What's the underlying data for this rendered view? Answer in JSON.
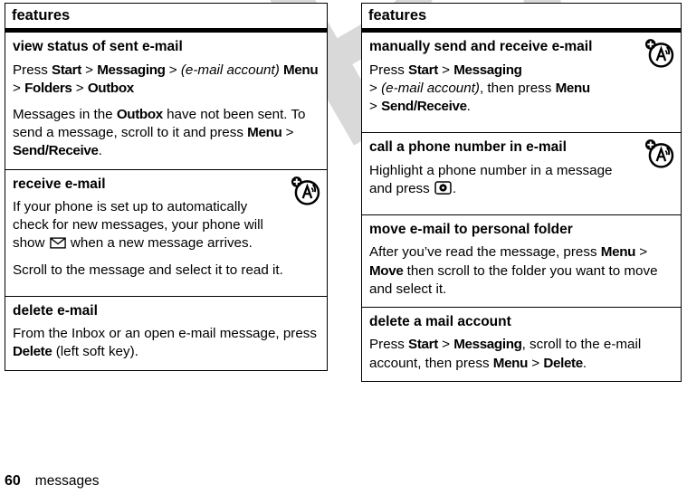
{
  "watermark": {
    "text": "DRAFT",
    "color": "#d9d9d9"
  },
  "footer": {
    "page_number": "60",
    "section_label": "messages"
  },
  "columns": [
    {
      "id": "left",
      "header": "features",
      "rows": [
        {
          "title": "view status of sent e-mail",
          "icon": null,
          "paragraphs": [
            [
              {
                "t": "Press ",
                "s": "normal"
              },
              {
                "t": "Start",
                "s": "bold"
              },
              {
                "t": " > ",
                "s": "normal"
              },
              {
                "t": "Messaging",
                "s": "bold"
              },
              {
                "t": " > ",
                "s": "normal"
              },
              {
                "t": "(e-mail account)",
                "s": "italic"
              },
              {
                "t": " ",
                "s": "normal"
              },
              {
                "t": "Menu",
                "s": "bold"
              },
              {
                "t": " > ",
                "s": "normal"
              },
              {
                "t": "Folders",
                "s": "bold"
              },
              {
                "t": " > ",
                "s": "normal"
              },
              {
                "t": "Outbox",
                "s": "bold"
              }
            ],
            [
              {
                "t": "Messages in the ",
                "s": "normal"
              },
              {
                "t": "Outbox",
                "s": "bold"
              },
              {
                "t": " have not been sent. To send a message, scroll to it and press ",
                "s": "normal"
              },
              {
                "t": "Menu",
                "s": "bold"
              },
              {
                "t": " > ",
                "s": "normal"
              },
              {
                "t": "Send/Receive",
                "s": "bold"
              },
              {
                "t": ".",
                "s": "normal"
              }
            ]
          ]
        },
        {
          "title": "receive e-mail",
          "icon": "network-antenna-icon",
          "paragraphs": [
            [
              {
                "t": "If your phone is set up to automatically check for new messages, your phone will show ",
                "s": "normal"
              },
              {
                "t": "",
                "s": "glyph",
                "glyph": "envelope-icon"
              },
              {
                "t": " when a new message arrives.",
                "s": "normal"
              }
            ],
            [
              {
                "t": "Scroll to the message and select it to read it.",
                "s": "normal"
              }
            ]
          ]
        },
        {
          "title": "delete e-mail",
          "icon": null,
          "paragraphs": [
            [
              {
                "t": "From the Inbox or an open e-mail message, press ",
                "s": "normal"
              },
              {
                "t": "Delete",
                "s": "bold"
              },
              {
                "t": " (left soft key).",
                "s": "normal"
              }
            ]
          ]
        }
      ]
    },
    {
      "id": "right",
      "header": "features",
      "rows": [
        {
          "title": "manually send and receive e-mail",
          "icon": "network-antenna-icon",
          "paragraphs": [
            [
              {
                "t": "Press ",
                "s": "normal"
              },
              {
                "t": "Start",
                "s": "bold"
              },
              {
                "t": " > ",
                "s": "normal"
              },
              {
                "t": "Messaging",
                "s": "bold"
              },
              {
                "t": "\n> ",
                "s": "normal"
              },
              {
                "t": "(e-mail account)",
                "s": "italic"
              },
              {
                "t": ", then press ",
                "s": "normal"
              },
              {
                "t": "Menu",
                "s": "bold"
              },
              {
                "t": "\n> ",
                "s": "normal"
              },
              {
                "t": "Send/Receive",
                "s": "bold"
              },
              {
                "t": ".",
                "s": "normal"
              }
            ]
          ]
        },
        {
          "title": "call a phone number in e-mail",
          "icon": "network-antenna-icon",
          "paragraphs": [
            [
              {
                "t": "Highlight a phone number in a message and press ",
                "s": "normal"
              },
              {
                "t": "",
                "s": "glyph",
                "glyph": "call-key-icon"
              },
              {
                "t": ".",
                "s": "normal"
              }
            ]
          ]
        },
        {
          "title": "move e-mail to personal folder",
          "icon": null,
          "paragraphs": [
            [
              {
                "t": "After you’ve read the message, press ",
                "s": "normal"
              },
              {
                "t": "Menu",
                "s": "bold"
              },
              {
                "t": " > ",
                "s": "normal"
              },
              {
                "t": "Move",
                "s": "bold"
              },
              {
                "t": " then scroll to the folder you want to move and select it.",
                "s": "normal"
              }
            ]
          ]
        },
        {
          "title": "delete a mail account",
          "icon": null,
          "paragraphs": [
            [
              {
                "t": "Press ",
                "s": "normal"
              },
              {
                "t": "Start",
                "s": "bold"
              },
              {
                "t": " > ",
                "s": "normal"
              },
              {
                "t": "Messaging",
                "s": "bold"
              },
              {
                "t": ", scroll to the e-mail account, then press ",
                "s": "normal"
              },
              {
                "t": "Menu",
                "s": "bold"
              },
              {
                "t": " > ",
                "s": "normal"
              },
              {
                "t": "Delete",
                "s": "bold"
              },
              {
                "t": ".",
                "s": "normal"
              }
            ]
          ]
        }
      ]
    }
  ]
}
